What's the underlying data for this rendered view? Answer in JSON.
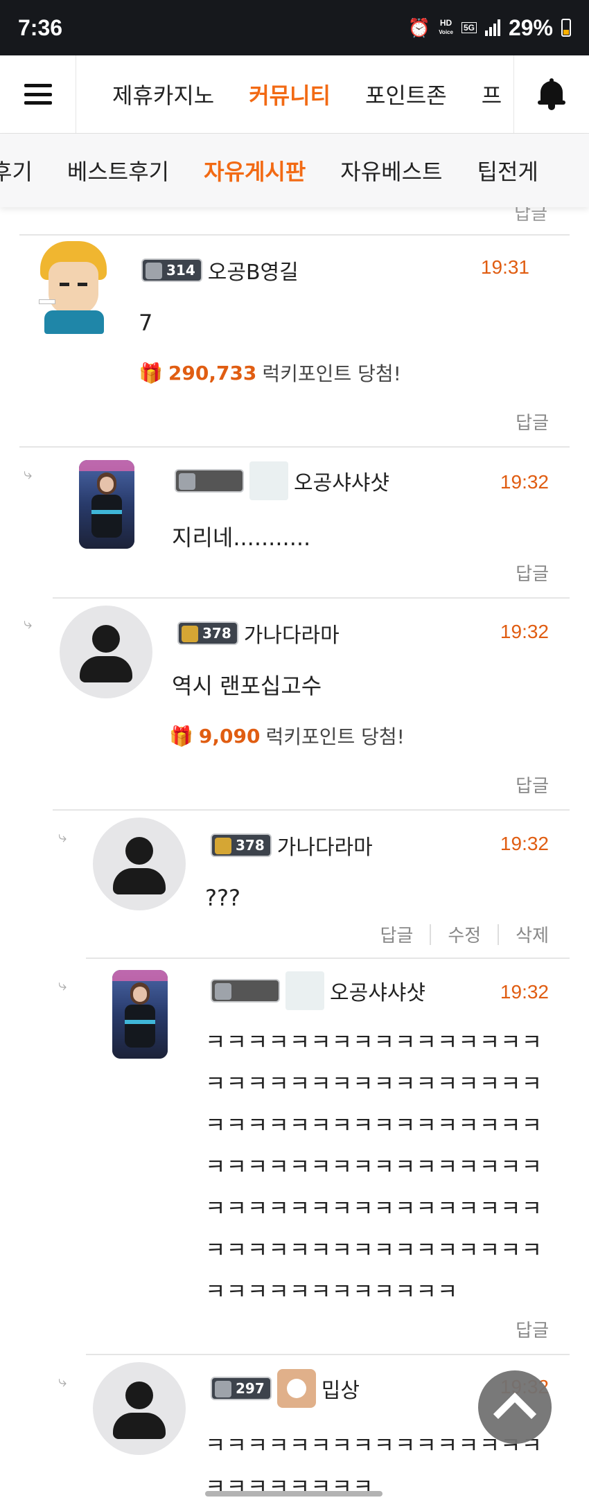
{
  "status_bar": {
    "time": "7:36",
    "hd_label": "HD",
    "voice_label": "Voice",
    "network": "5G",
    "battery": "29%"
  },
  "top_nav": {
    "items": [
      "제휴카지노",
      "커뮤니티",
      "포인트존",
      "프"
    ],
    "active_index": 1
  },
  "sub_nav": {
    "items": [
      "후기",
      "베스트후기",
      "자유게시판",
      "자유베스트",
      "팁전게"
    ],
    "active_index": 2
  },
  "reply_peek": "답글",
  "comments": [
    {
      "level": "314",
      "username": "오공B영길",
      "time": "19:31",
      "content": "7",
      "prize_amount": "290,733",
      "prize_text": "럭키포인트 당첨!",
      "actions": [
        "답글"
      ]
    },
    {
      "level": "",
      "username": "오공샤샤샷",
      "time": "19:32",
      "content": "지리네...........",
      "actions": [
        "답글"
      ]
    },
    {
      "level": "378",
      "username": "가나다라마",
      "time": "19:32",
      "content": "역시 랜포십고수",
      "prize_amount": "9,090",
      "prize_text": "럭키포인트 당첨!",
      "actions": [
        "답글"
      ]
    },
    {
      "level": "378",
      "username": "가나다라마",
      "time": "19:32",
      "content": "???",
      "actions": [
        "답글",
        "수정",
        "삭제"
      ]
    },
    {
      "level": "",
      "username": "오공샤샤샷",
      "time": "19:32",
      "content": "ㅋㅋㅋㅋㅋㅋㅋㅋㅋㅋㅋㅋㅋㅋㅋㅋㅋㅋㅋㅋㅋㅋㅋㅋㅋㅋㅋㅋㅋㅋㅋㅋㅋㅋㅋㅋㅋㅋㅋㅋㅋㅋㅋㅋㅋㅋㅋㅋㅋㅋㅋㅋㅋㅋㅋㅋㅋㅋㅋㅋㅋㅋㅋㅋㅋㅋㅋㅋㅋㅋㅋㅋㅋㅋㅋㅋㅋㅋㅋㅋㅋㅋㅋㅋㅋㅋㅋㅋㅋㅋㅋㅋㅋㅋㅋㅋㅋㅋㅋㅋㅋㅋㅋㅋㅋㅋㅋㅋ",
      "actions": [
        "답글"
      ]
    },
    {
      "level": "297",
      "username": "밉상",
      "time": "19:32",
      "content": "ㅋㅋㅋㅋㅋㅋㅋㅋㅋㅋㅋㅋㅋㅋㅋㅋㅋㅋㅋㅋㅋㅋㅋㅋ"
    }
  ],
  "colors": {
    "accent": "#f26a14",
    "time": "#e05d12",
    "status_bar_bg": "#16181c"
  },
  "icons": {
    "alarm": "alarm-icon",
    "menu": "hamburger-menu-icon",
    "bell": "bell-icon",
    "gift": "gift-icon",
    "reply_arrow": "reply-arrow-icon",
    "scroll_top": "chevron-up-icon"
  }
}
